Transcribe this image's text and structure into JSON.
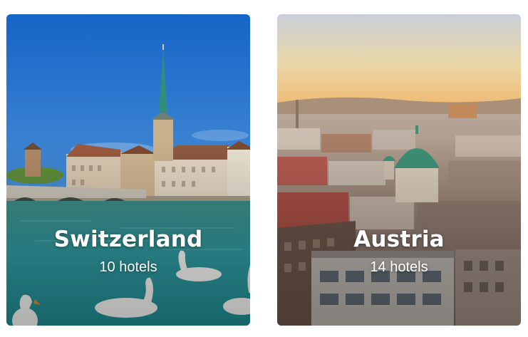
{
  "destinations": [
    {
      "name": "Switzerland",
      "hotels_label": "10 hotels"
    },
    {
      "name": "Austria",
      "hotels_label": "14 hotels"
    }
  ]
}
